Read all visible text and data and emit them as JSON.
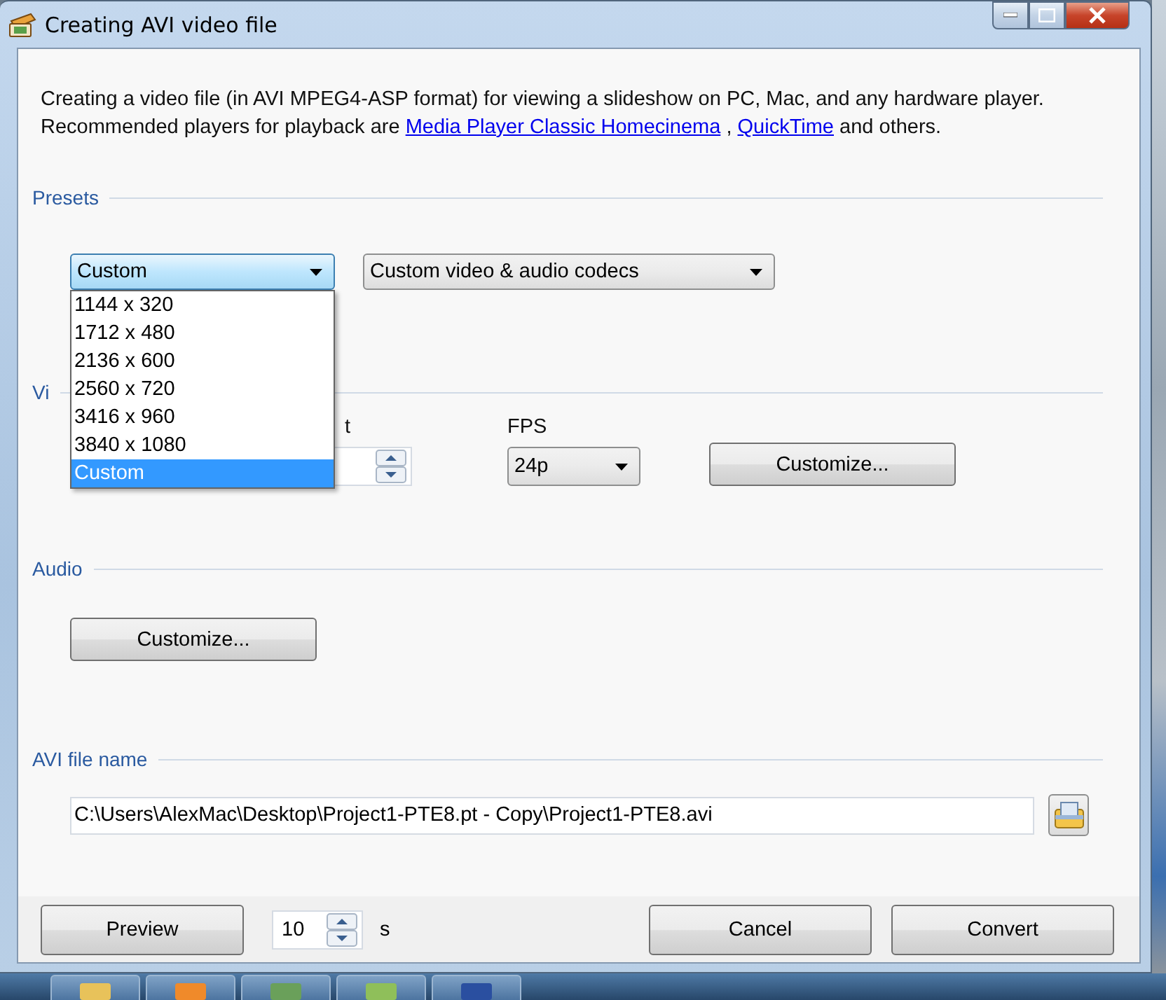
{
  "window": {
    "title": "Creating AVI video file"
  },
  "description": {
    "line_1": "Creating a video file (in AVI MPEG4-ASP format) for viewing a slideshow on PC, Mac, and any hardware player.",
    "line_2": "Recommended players for playback are",
    "links": [
      "Media Player Classic Homecinema",
      "QuickTime"
    ],
    "separator": ",",
    "suffix": "and others."
  },
  "presets": {
    "heading": "Presets",
    "resolution": {
      "value": "Custom",
      "open": true,
      "options": [
        {
          "label": "1144 x 320",
          "selected": false
        },
        {
          "label": "1712 x 480",
          "selected": false
        },
        {
          "label": "2136 x 600",
          "selected": false
        },
        {
          "label": "2560 x 720",
          "selected": false
        },
        {
          "label": "3416 x 960",
          "selected": false
        },
        {
          "label": "3840 x 1080",
          "selected": false
        },
        {
          "label": "Custom",
          "selected": true
        }
      ]
    },
    "codecs": {
      "value": "Custom video & audio codecs"
    }
  },
  "video": {
    "heading": "Vi",
    "size_label": "t",
    "fps_label": "FPS",
    "fps": {
      "value": "24p"
    },
    "customize": "Customize..."
  },
  "audio": {
    "heading": "Audio",
    "customize": "Customize..."
  },
  "file": {
    "heading": "AVI file name",
    "path": "C:\\Users\\AlexMac\\Desktop\\Project1-PTE8.pt - Copy\\Project1-PTE8.avi"
  },
  "footer": {
    "preview": "Preview",
    "duration": "10",
    "unit": "s",
    "cancel": "Cancel",
    "convert": "Convert"
  }
}
